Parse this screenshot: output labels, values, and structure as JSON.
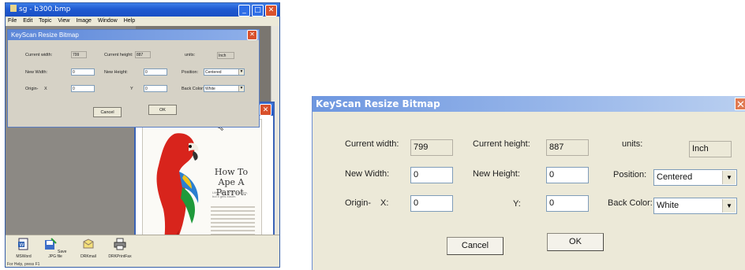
{
  "app": {
    "title": "sg - b300.bmp",
    "menu": [
      "File",
      "Edit",
      "Topic",
      "View",
      "Image",
      "Window",
      "Help"
    ],
    "status": "For Help, press F1",
    "taskbar": [
      {
        "label": "MSWord",
        "icon": "word-doc-icon"
      },
      {
        "label": "Save JPG file",
        "icon": "save-jpg-icon"
      },
      {
        "label": "DRKmail",
        "icon": "email-icon"
      },
      {
        "label": "DRKPrintFax",
        "icon": "print-fax-icon"
      }
    ],
    "poster": {
      "title": "How To Ape A Parrot.",
      "subtitle": "Life might be all scissors, but it gets easier."
    }
  },
  "dialog": {
    "title": "KeyScan Resize Bitmap",
    "current_width_label": "Current width:",
    "current_width": "799",
    "current_height_label": "Current height:",
    "current_height": "887",
    "units_label": "units:",
    "units": "Inch",
    "new_width_label": "New Width:",
    "new_width": "0",
    "new_height_label": "New Height:",
    "new_height": "0",
    "position_label": "Position:",
    "position": "Centered",
    "origin_label": "Origin-",
    "x_label": "X:",
    "origin_x": "0",
    "y_label": "Y:",
    "origin_y": "0",
    "back_color_label": "Back Color:",
    "back_color": "White",
    "cancel_label": "Cancel",
    "ok_label": "OK"
  },
  "mini_dialog": {
    "x_label": "X",
    "y_label": "Y"
  },
  "colors": {
    "titlebar": "#1f5ad1",
    "dialog_title": "#6e97e0",
    "dialog_face": "#ece9d8",
    "close": "#e07a52"
  }
}
